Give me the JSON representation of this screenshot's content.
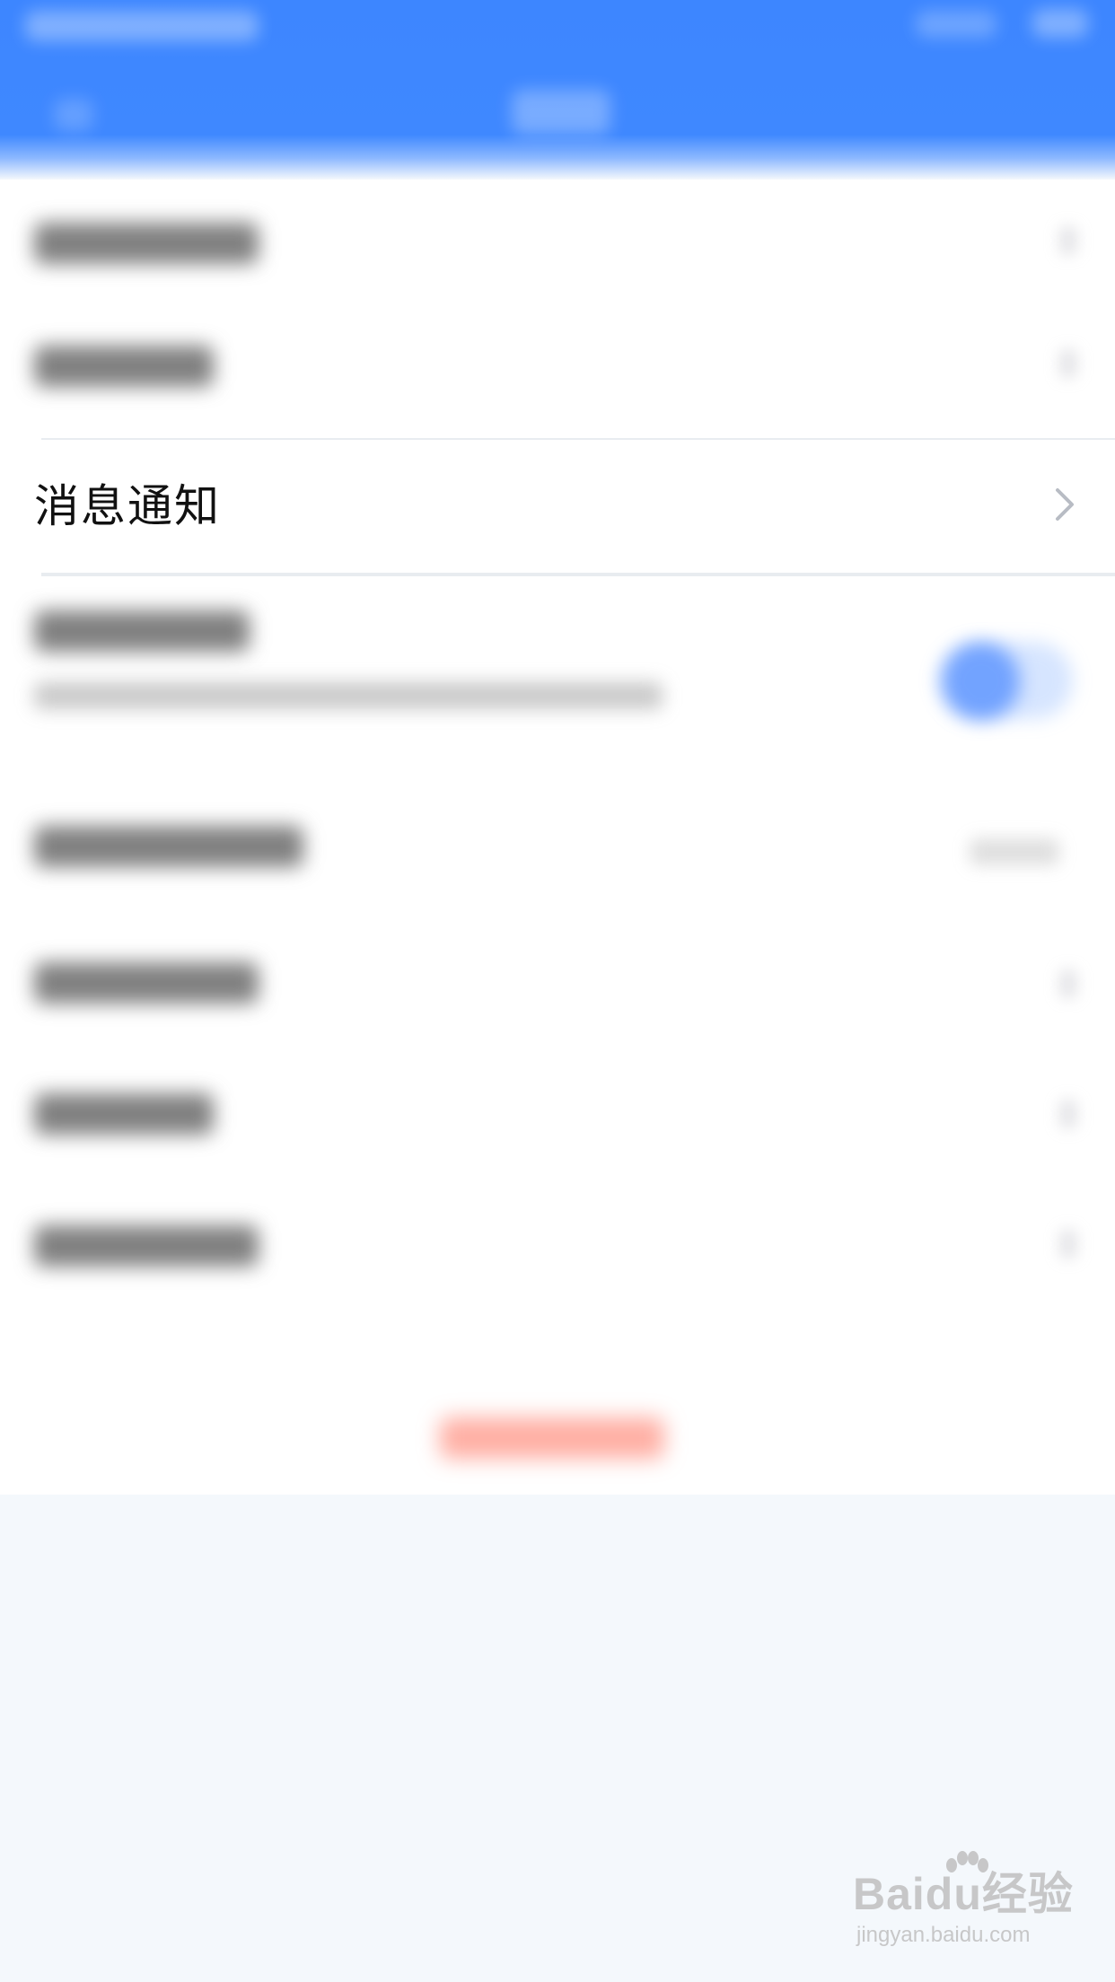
{
  "settings": {
    "notification_item": {
      "label": "消息通知",
      "icon": "chevron-right-icon"
    }
  },
  "watermark": {
    "brand": "Baidu经验",
    "url": "jingyan.baidu.com"
  },
  "colors": {
    "header_blue": "#3d86ff",
    "background": "#f4f8fc",
    "text": "#111111",
    "chevron": "#b8bcc4",
    "logout_red": "#ff6e5a"
  }
}
